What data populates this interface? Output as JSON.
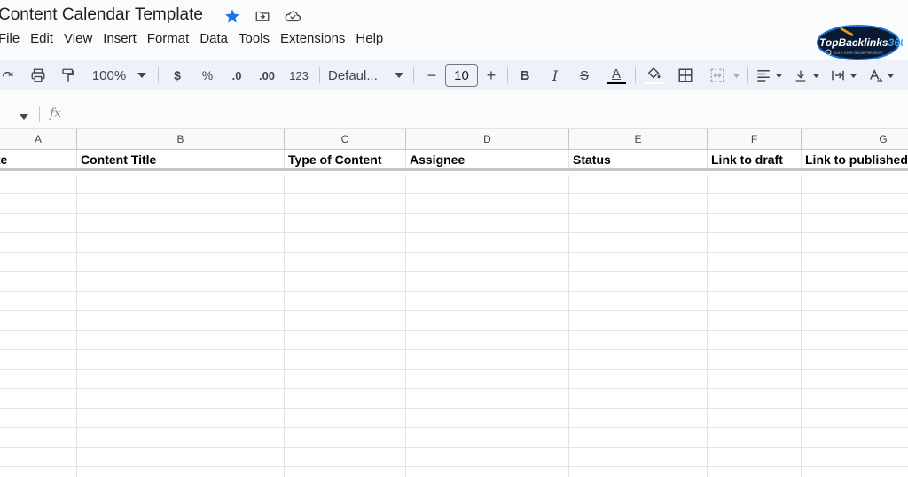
{
  "document": {
    "title": "Content Calendar Template"
  },
  "menu": [
    "File",
    "Edit",
    "View",
    "Insert",
    "Format",
    "Data",
    "Tools",
    "Extensions",
    "Help"
  ],
  "logo": {
    "text": "TopBacklinks360",
    "text_top": "Top",
    "text_mid": "Backlinks",
    "text_end": "360",
    "tagline": "BUILD YOUR ONLINE PRESENCE"
  },
  "toolbar": {
    "zoom": "100%",
    "currency": "$",
    "percent": "%",
    "decrease_decimal": ".0",
    "increase_decimal": ".00",
    "number_format": "123",
    "font": "Defaul...",
    "font_size": "10",
    "minus": "−",
    "plus": "+",
    "bold": "B",
    "italic": "I",
    "strike": "S",
    "text_color": "A"
  },
  "formula_bar": {
    "fx": "fx"
  },
  "columns": [
    "A",
    "B",
    "C",
    "D",
    "E",
    "F",
    "G"
  ],
  "header_cells": [
    "Date",
    "Content Title",
    "Type of Content",
    "Assignee",
    "Status",
    "Link to draft",
    "Link to published"
  ],
  "colors": {
    "accent_star": "#1a73e8",
    "toolbar_bg": "#edf2fa",
    "page_bg": "#f9fbfd"
  }
}
